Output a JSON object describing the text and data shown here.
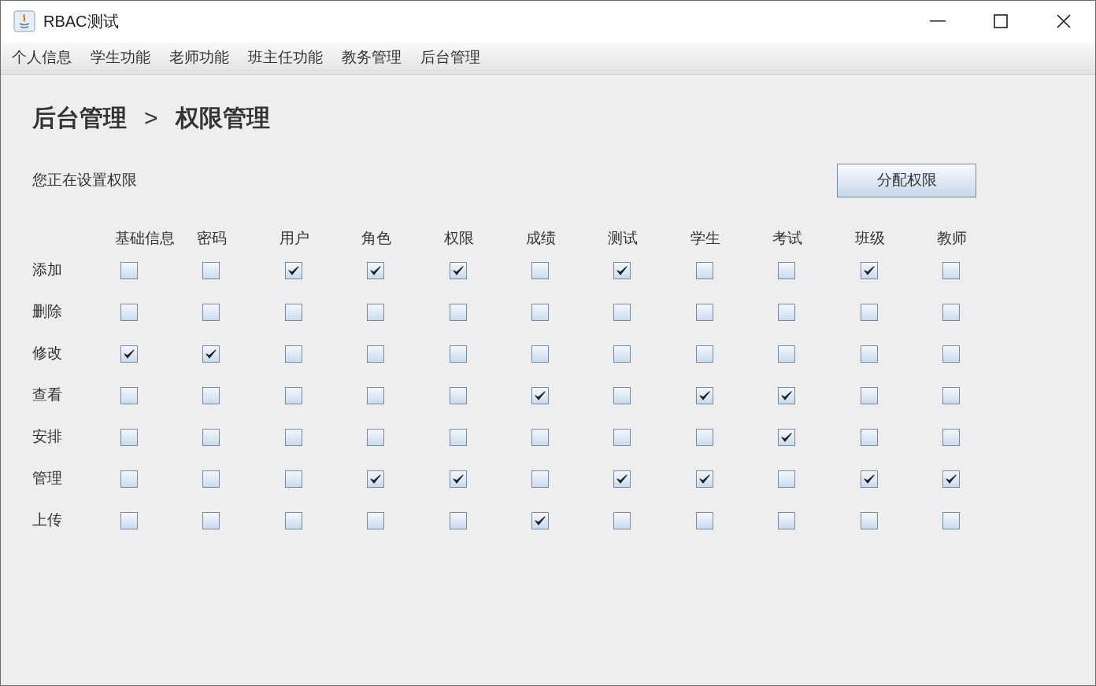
{
  "window": {
    "title": "RBAC测试"
  },
  "menu": [
    "个人信息",
    "学生功能",
    "老师功能",
    "班主任功能",
    "教务管理",
    "后台管理"
  ],
  "breadcrumb": {
    "parent": "后台管理",
    "separator": ">",
    "current": "权限管理"
  },
  "prompt": "您正在设置权限",
  "assign_button": "分配权限",
  "columns": [
    "基础信息",
    "密码",
    "用户",
    "角色",
    "权限",
    "成绩",
    "测试",
    "学生",
    "考试",
    "班级",
    "教师"
  ],
  "rows": [
    {
      "label": "添加",
      "cells": [
        {
          "checked": false
        },
        {
          "checked": false
        },
        {
          "checked": true
        },
        {
          "checked": true
        },
        {
          "checked": true
        },
        {
          "checked": false
        },
        {
          "checked": true
        },
        {
          "checked": false
        },
        {
          "checked": false
        },
        {
          "checked": true
        },
        {
          "checked": false
        }
      ]
    },
    {
      "label": "删除",
      "cells": [
        {
          "checked": false
        },
        {
          "checked": false
        },
        {
          "checked": false
        },
        {
          "checked": false
        },
        {
          "checked": false
        },
        {
          "checked": false
        },
        {
          "checked": false
        },
        {
          "checked": false
        },
        {
          "checked": false
        },
        {
          "checked": false
        },
        {
          "checked": false
        }
      ]
    },
    {
      "label": "修改",
      "cells": [
        {
          "checked": true
        },
        {
          "checked": true
        },
        {
          "checked": false
        },
        {
          "checked": false
        },
        {
          "checked": false
        },
        {
          "checked": false
        },
        {
          "checked": false
        },
        {
          "checked": false
        },
        {
          "checked": false
        },
        {
          "checked": false
        },
        {
          "checked": false
        }
      ]
    },
    {
      "label": "查看",
      "cells": [
        {
          "checked": false
        },
        {
          "checked": false
        },
        {
          "checked": false
        },
        {
          "checked": false
        },
        {
          "checked": false
        },
        {
          "checked": true
        },
        {
          "checked": false
        },
        {
          "checked": true
        },
        {
          "checked": true
        },
        {
          "checked": false
        },
        {
          "checked": false
        }
      ]
    },
    {
      "label": "安排",
      "cells": [
        {
          "checked": false
        },
        {
          "checked": false
        },
        {
          "checked": false
        },
        {
          "checked": false
        },
        {
          "checked": false
        },
        {
          "checked": false
        },
        {
          "checked": false
        },
        {
          "checked": false
        },
        {
          "checked": true
        },
        {
          "checked": false
        },
        {
          "checked": false
        }
      ]
    },
    {
      "label": "管理",
      "cells": [
        {
          "checked": false
        },
        {
          "checked": false
        },
        {
          "checked": false
        },
        {
          "checked": true
        },
        {
          "checked": true
        },
        {
          "checked": false
        },
        {
          "checked": true
        },
        {
          "checked": true
        },
        {
          "checked": false
        },
        {
          "checked": true
        },
        {
          "checked": true
        }
      ]
    },
    {
      "label": "上传",
      "cells": [
        {
          "checked": false
        },
        {
          "checked": false
        },
        {
          "checked": false
        },
        {
          "checked": false
        },
        {
          "checked": false
        },
        {
          "checked": true
        },
        {
          "checked": false
        },
        {
          "checked": false
        },
        {
          "checked": false
        },
        {
          "checked": false
        },
        {
          "checked": false
        }
      ]
    }
  ]
}
